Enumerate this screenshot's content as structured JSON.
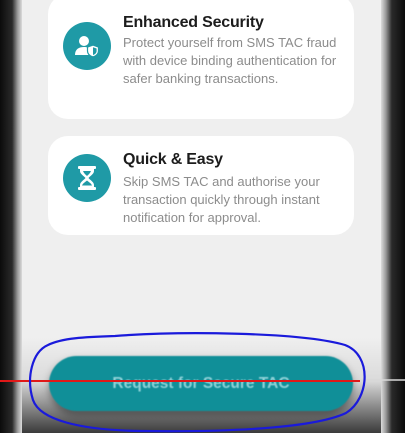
{
  "features": [
    {
      "icon": "user-shield-icon",
      "title": "Enhanced Security",
      "description": "Protect yourself from SMS TAC fraud with device binding authentication for safer banking transactions."
    },
    {
      "icon": "hourglass-icon",
      "title": "Quick & Easy",
      "description": "Skip SMS TAC and authorise your transaction quickly through instant notification for approval."
    }
  ],
  "cta": {
    "label": "Request for Secure TAC"
  },
  "colors": {
    "accent": "#1f9aa6",
    "button": "#108f98",
    "button_text": "#8fd2d8",
    "annotation_circle": "#1a1adb",
    "annotation_line": "#e01818"
  }
}
